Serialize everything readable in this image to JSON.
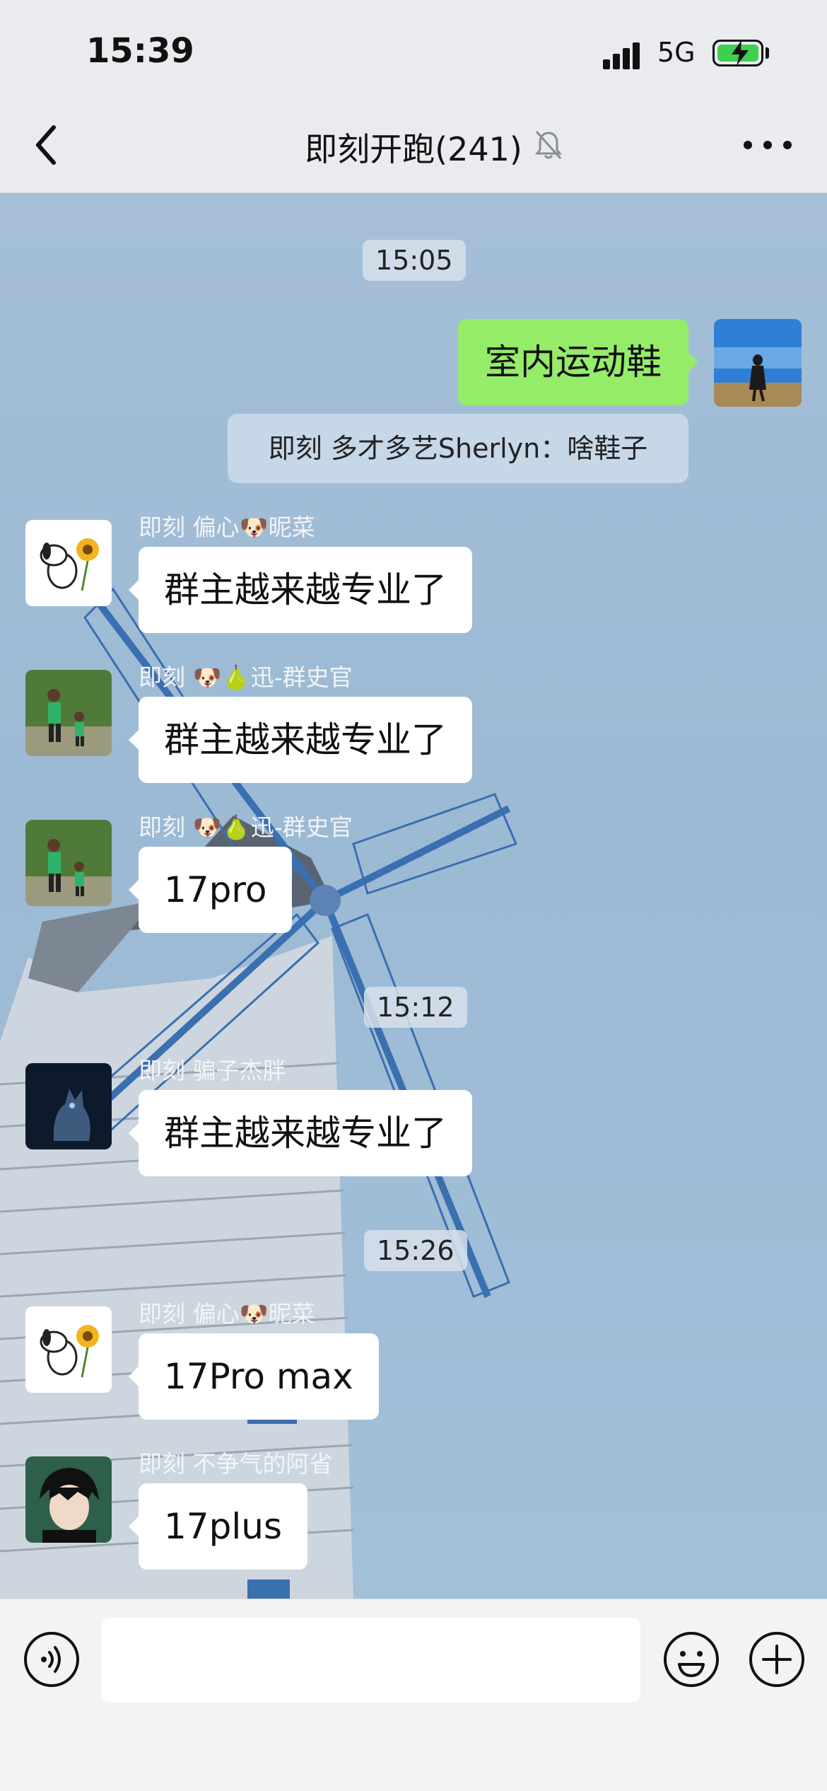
{
  "status_bar": {
    "time": "15:39",
    "network": "5G",
    "battery_icon": "battery-charging-icon"
  },
  "nav": {
    "title": "即刻开跑(241)",
    "back_icon": "chevron-left-icon",
    "mute_icon": "bell-muted-icon",
    "more_icon": "more-dots-icon"
  },
  "messages": {
    "ts1": "15:05",
    "self_text": "室内运动鞋",
    "system_text": "即刻 多才多艺Sherlyn：啥鞋子",
    "m1": {
      "sender": "即刻 偏心🐶昵菜",
      "text": "群主越来越专业了"
    },
    "m2": {
      "sender": "即刻 🐶🍐迅-群史官",
      "text": "群主越来越专业了"
    },
    "m3": {
      "sender": "即刻 🐶🍐迅-群史官",
      "text": "17pro"
    },
    "ts2": "15:12",
    "m4": {
      "sender": "即刻 骗子杰胖",
      "text": "群主越来越专业了"
    },
    "ts3": "15:26",
    "m5": {
      "sender": "即刻 偏心🐶昵菜",
      "text": "17Pro max"
    },
    "m6": {
      "sender": "即刻 不争气的阿省",
      "text": "17plus"
    }
  },
  "input_bar": {
    "placeholder": "",
    "voice_icon": "voice-icon",
    "emoji_icon": "emoji-icon",
    "plus_icon": "plus-icon"
  },
  "colors": {
    "self_bubble": "#95ec69",
    "other_bubble": "#ffffff",
    "chat_bg": "#a4bfd7"
  }
}
